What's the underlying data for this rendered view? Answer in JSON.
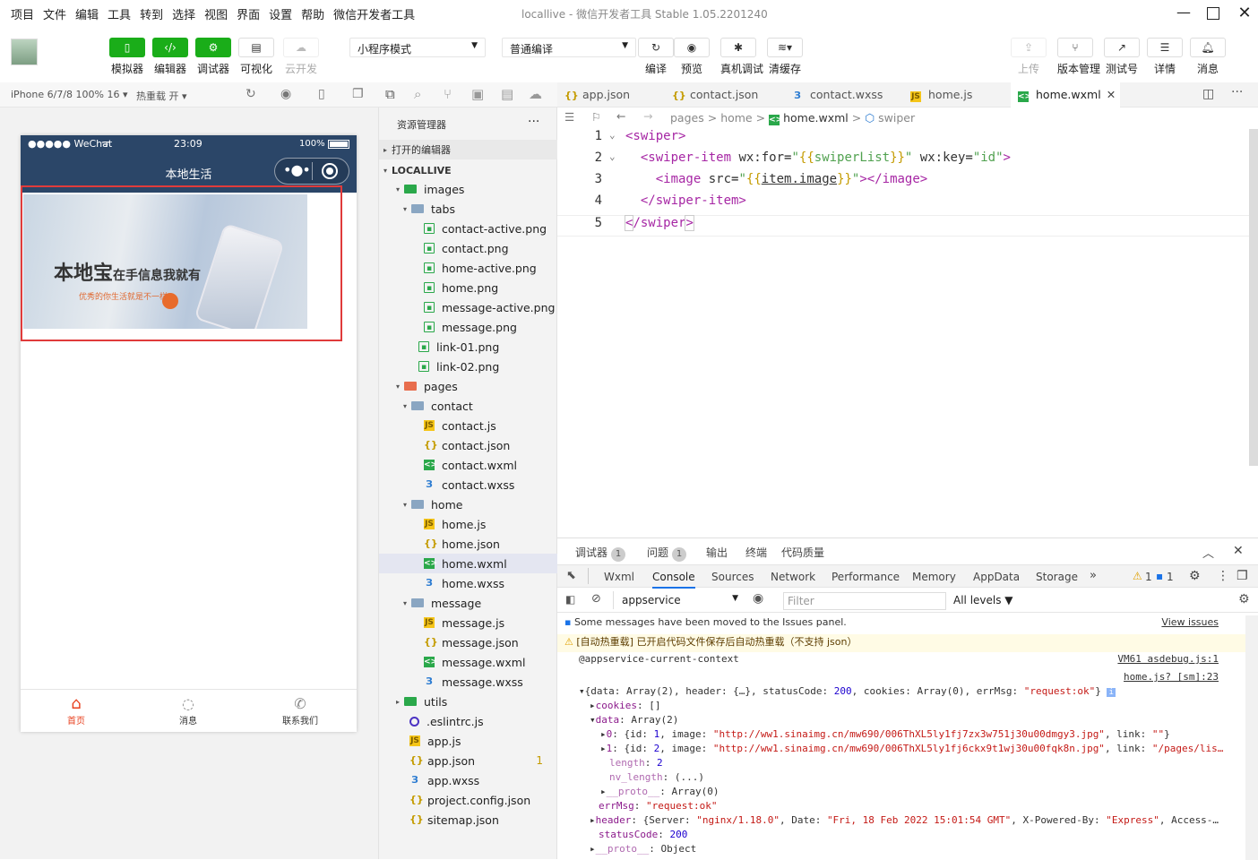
{
  "menu": [
    "项目",
    "文件",
    "编辑",
    "工具",
    "转到",
    "选择",
    "视图",
    "界面",
    "设置",
    "帮助",
    "微信开发者工具"
  ],
  "window": {
    "project": "locallive",
    "sep": " - ",
    "app": "微信开发者工具 Stable 1.05.2201240"
  },
  "toolbar": {
    "left": [
      {
        "label": "模拟器",
        "icon": "phone-icon"
      },
      {
        "label": "编辑器",
        "icon": "code-icon"
      },
      {
        "label": "调试器",
        "icon": "debug-icon"
      },
      {
        "label": "可视化",
        "icon": "layout-icon"
      },
      {
        "label": "云开发",
        "icon": "cloud-icon"
      }
    ],
    "mode": "小程序模式",
    "compile": "普通编译",
    "mid": [
      {
        "label": "编译",
        "icon": "refresh-icon"
      },
      {
        "label": "预览",
        "icon": "eye-icon"
      },
      {
        "label": "真机调试",
        "icon": "bug-icon"
      },
      {
        "label": "清缓存",
        "icon": "layers-icon"
      }
    ],
    "right": [
      {
        "label": "上传",
        "icon": "upload-icon"
      },
      {
        "label": "版本管理",
        "icon": "branch-icon"
      },
      {
        "label": "测试号",
        "icon": "external-icon"
      },
      {
        "label": "详情",
        "icon": "menu-icon"
      },
      {
        "label": "消息",
        "icon": "bell-icon"
      }
    ]
  },
  "sim": {
    "device": "iPhone 6/7/8 100% 16",
    "reload": "热重载 开",
    "status_left": "●●●●● WeChat",
    "time": "23:09",
    "battery": "100%",
    "nav_title": "本地生活",
    "banner_text": "本地宝",
    "banner_sub": "在手信息我就有",
    "banner_small": "优秀的你生活就是不一样",
    "tabs": [
      {
        "label": "首页"
      },
      {
        "label": "消息"
      },
      {
        "label": "联系我们"
      }
    ]
  },
  "explorer": {
    "title": "资源管理器",
    "more": "···",
    "open_editors": "打开的编辑器",
    "root": "LOCALLIVE",
    "items": [
      {
        "name": "images",
        "type": "folderg",
        "depth": 1,
        "arrow": "▾"
      },
      {
        "name": "tabs",
        "type": "folder",
        "depth": 2,
        "arrow": "▾"
      },
      {
        "name": "contact-active.png",
        "type": "png",
        "depth": 3
      },
      {
        "name": "contact.png",
        "type": "png",
        "depth": 3
      },
      {
        "name": "home-active.png",
        "type": "png",
        "depth": 3
      },
      {
        "name": "home.png",
        "type": "png",
        "depth": 3
      },
      {
        "name": "message-active.png",
        "type": "png",
        "depth": 3
      },
      {
        "name": "message.png",
        "type": "png",
        "depth": 3
      },
      {
        "name": "link-01.png",
        "type": "png",
        "depth": 2
      },
      {
        "name": "link-02.png",
        "type": "png",
        "depth": 2
      },
      {
        "name": "pages",
        "type": "folderr",
        "depth": 1,
        "arrow": "▾"
      },
      {
        "name": "contact",
        "type": "folder",
        "depth": 2,
        "arrow": "▾"
      },
      {
        "name": "contact.js",
        "type": "js",
        "depth": 3
      },
      {
        "name": "contact.json",
        "type": "json",
        "depth": 3
      },
      {
        "name": "contact.wxml",
        "type": "wxml",
        "depth": 3
      },
      {
        "name": "contact.wxss",
        "type": "wxss",
        "depth": 3
      },
      {
        "name": "home",
        "type": "folder",
        "depth": 2,
        "arrow": "▾"
      },
      {
        "name": "home.js",
        "type": "js",
        "depth": 3
      },
      {
        "name": "home.json",
        "type": "json",
        "depth": 3
      },
      {
        "name": "home.wxml",
        "type": "wxml",
        "depth": 3,
        "selected": true
      },
      {
        "name": "home.wxss",
        "type": "wxss",
        "depth": 3
      },
      {
        "name": "message",
        "type": "folder",
        "depth": 2,
        "arrow": "▾"
      },
      {
        "name": "message.js",
        "type": "js",
        "depth": 3
      },
      {
        "name": "message.json",
        "type": "json",
        "depth": 3
      },
      {
        "name": "message.wxml",
        "type": "wxml",
        "depth": 3
      },
      {
        "name": "message.wxss",
        "type": "wxss",
        "depth": 3
      },
      {
        "name": "utils",
        "type": "folderg",
        "depth": 1,
        "arrow": "▸"
      },
      {
        "name": ".eslintrc.js",
        "type": "eslint",
        "depth": 1
      },
      {
        "name": "app.js",
        "type": "js",
        "depth": 1
      },
      {
        "name": "app.json",
        "type": "json",
        "depth": 1,
        "badge": "1"
      },
      {
        "name": "app.wxss",
        "type": "wxss",
        "depth": 1
      },
      {
        "name": "project.config.json",
        "type": "json",
        "depth": 1
      },
      {
        "name": "sitemap.json",
        "type": "json",
        "depth": 1
      }
    ]
  },
  "editor": {
    "tabs": [
      {
        "name": "app.json",
        "icon": "json"
      },
      {
        "name": "contact.json",
        "icon": "json"
      },
      {
        "name": "contact.wxss",
        "icon": "wxss"
      },
      {
        "name": "home.js",
        "icon": "js"
      },
      {
        "name": "home.wxml",
        "icon": "wxml",
        "active": true
      }
    ],
    "crumbs": [
      "pages",
      ">",
      "home",
      ">",
      "home.wxml",
      ">",
      "swiper"
    ],
    "lines": [
      "1",
      "2",
      "3",
      "4",
      "5"
    ]
  },
  "debug": {
    "tabs": [
      {
        "label": "调试器",
        "badge": "1"
      },
      {
        "label": "问题",
        "badge": "1"
      },
      {
        "label": "输出"
      },
      {
        "label": "终端"
      },
      {
        "label": "代码质量"
      }
    ],
    "devtabs": [
      "Wxml",
      "Console",
      "Sources",
      "Network",
      "Performance",
      "Memory",
      "AppData",
      "Storage"
    ],
    "warn_count": "1",
    "info_count": "1",
    "context": "appservice",
    "filter_placeholder": "Filter",
    "levels": "All levels ▼",
    "msg1": "Some messages have been moved to the Issues panel.",
    "msg1_link": "View issues",
    "msg2": "[自动热重载] 已开启代码文件保存后自动热重载（不支持 json）",
    "msg3": "@appservice-current-context",
    "msg3_link": "VM61 asdebug.js:1",
    "msg4_link": "home.js? [sm]:23"
  }
}
